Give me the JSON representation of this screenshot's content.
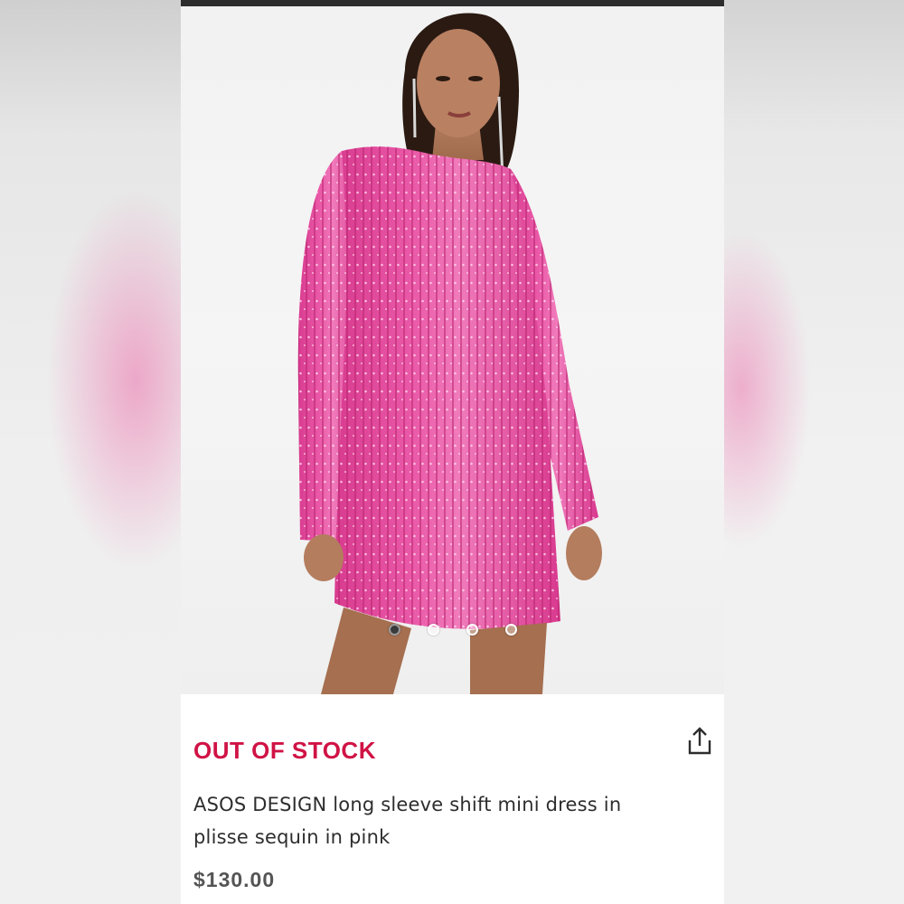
{
  "product": {
    "stock_status": "OUT OF STOCK",
    "title": "ASOS DESIGN long sleeve shift mini dress in plisse sequin in pink",
    "price": "$130.00",
    "image_description": "model wearing pink sequin long sleeve mini dress"
  },
  "gallery": {
    "image_count": 4,
    "active_index": 0
  },
  "icons": {
    "share": "share-icon"
  },
  "colors": {
    "stock_status": "#d01345",
    "dress": "#e0439a",
    "text": "#2d2d2d"
  }
}
